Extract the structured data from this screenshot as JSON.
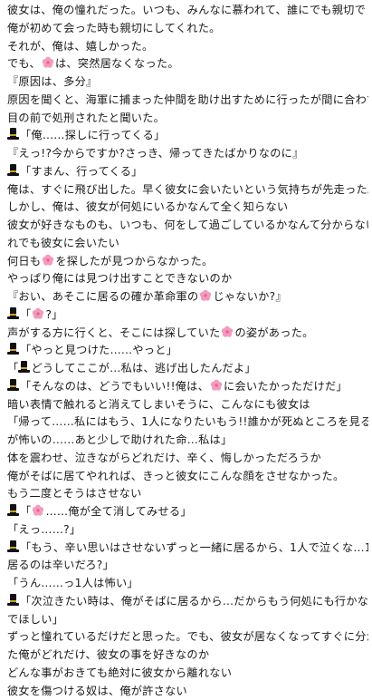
{
  "icons": {
    "hat": "top-hat-icon",
    "flower": "cherry-blossom-icon"
  },
  "colors": {
    "text": "#1a1a1a",
    "background": "#ffffff",
    "flower": "#f29bbf",
    "hat": "#111111"
  },
  "lines": [
    {
      "segments": [
        {
          "t": "text",
          "v": "彼女は、俺の憧れだった。いつも、みんなに慕われて、誰にでも親切で"
        }
      ]
    },
    {
      "segments": [
        {
          "t": "text",
          "v": "俺が初めて会った時も親切にしてくれた。"
        }
      ]
    },
    {
      "segments": [
        {
          "t": "text",
          "v": "それが、俺は、嬉しかった。"
        }
      ]
    },
    {
      "segments": [
        {
          "t": "text",
          "v": "でも、"
        },
        {
          "t": "flower"
        },
        {
          "t": "text",
          "v": "は、突然居なくなった。"
        }
      ]
    },
    {
      "segments": [
        {
          "t": "text",
          "v": "『原因は、多分』"
        }
      ]
    },
    {
      "segments": [
        {
          "t": "text",
          "v": "原因を聞くと、海軍に捕まった仲間を助け出すために行ったが間に合わず"
        }
      ]
    },
    {
      "segments": [
        {
          "t": "text",
          "v": "目の前で処刑されたと聞いた。"
        }
      ]
    },
    {
      "segments": [
        {
          "t": "hat"
        },
        {
          "t": "text",
          "v": "「俺……探しに行ってくる」"
        }
      ]
    },
    {
      "segments": [
        {
          "t": "text",
          "v": "『えっ!?今からですか?さっき、帰ってきたばかりなのに』"
        }
      ]
    },
    {
      "segments": [
        {
          "t": "hat"
        },
        {
          "t": "text",
          "v": "「すまん、行ってくる」"
        }
      ]
    },
    {
      "segments": [
        {
          "t": "text",
          "v": "俺は、すぐに飛び出した。早く彼女に会いたいという気持ちが先走った。"
        }
      ]
    },
    {
      "segments": [
        {
          "t": "text",
          "v": "しかし、俺は、彼女が何処にいるかなんて全く知らない"
        }
      ]
    },
    {
      "segments": [
        {
          "t": "text",
          "v": "彼女が好きなものも、いつも、何をして過ごしているかなんて分からない、そ"
        }
      ]
    },
    {
      "segments": [
        {
          "t": "text",
          "v": "れでも彼女に会いたい"
        }
      ]
    },
    {
      "segments": [
        {
          "t": "text",
          "v": "何日も"
        },
        {
          "t": "flower"
        },
        {
          "t": "text",
          "v": "を探したが見つからなかった。"
        }
      ]
    },
    {
      "segments": [
        {
          "t": "text",
          "v": "やっぱり俺には見つけ出すことできないのか"
        }
      ]
    },
    {
      "segments": [
        {
          "t": "text",
          "v": "『おい、あそこに居るの確か革命軍の"
        },
        {
          "t": "flower"
        },
        {
          "t": "text",
          "v": "じゃないか?』"
        }
      ]
    },
    {
      "segments": [
        {
          "t": "hat"
        },
        {
          "t": "text",
          "v": "「"
        },
        {
          "t": "flower"
        },
        {
          "t": "text",
          "v": "?」"
        }
      ]
    },
    {
      "segments": [
        {
          "t": "text",
          "v": "声がする方に行くと、そこには探していた"
        },
        {
          "t": "flower"
        },
        {
          "t": "text",
          "v": "の姿があった。"
        }
      ]
    },
    {
      "segments": [
        {
          "t": "hat"
        },
        {
          "t": "text",
          "v": "「やっと見つけた……やっと」"
        }
      ]
    },
    {
      "segments": [
        {
          "t": "text",
          "v": "「"
        },
        {
          "t": "hat"
        },
        {
          "t": "text",
          "v": "どうしてここが…私は、逃げ出したんだよ」"
        }
      ]
    },
    {
      "segments": [
        {
          "t": "hat"
        },
        {
          "t": "text",
          "v": "「そんなのは、どうでもいい!!俺は、"
        },
        {
          "t": "flower"
        },
        {
          "t": "text",
          "v": "に会いたかっただけだ」"
        }
      ]
    },
    {
      "segments": [
        {
          "t": "text",
          "v": "暗い表情で触れると消えてしまいそうに、こんなにも彼女は"
        }
      ]
    },
    {
      "segments": [
        {
          "t": "text",
          "v": "「帰って……私にはもう、1人になりたいもう!!誰かが死ぬところを見るの"
        }
      ]
    },
    {
      "segments": [
        {
          "t": "text",
          "v": "が怖いの……あと少しで助けれた命…私は」"
        }
      ]
    },
    {
      "segments": [
        {
          "t": "text",
          "v": "体を震わせ、泣きながらどれだけ、辛く、悔しかっただろうか"
        }
      ]
    },
    {
      "segments": [
        {
          "t": "text",
          "v": "俺がそばに居てやれれば、きっと彼女にこんな顔をさせなかった。"
        }
      ]
    },
    {
      "segments": [
        {
          "t": "text",
          "v": "もう二度とそうはさせない"
        }
      ]
    },
    {
      "segments": [
        {
          "t": "hat"
        },
        {
          "t": "text",
          "v": "「"
        },
        {
          "t": "flower"
        },
        {
          "t": "text",
          "v": "……俺が全て消してみせる」"
        }
      ]
    },
    {
      "segments": [
        {
          "t": "text",
          "v": "「えっ……?」"
        }
      ]
    },
    {
      "segments": [
        {
          "t": "hat"
        },
        {
          "t": "text",
          "v": "「もう、辛い思いはさせないずっと一緒に居るから、1人で泣くな…1人で"
        }
      ]
    },
    {
      "segments": [
        {
          "t": "text",
          "v": "居るのは辛いだろ?」"
        }
      ]
    },
    {
      "segments": [
        {
          "t": "text",
          "v": "「うん……っ1人は怖い」"
        }
      ]
    },
    {
      "segments": [
        {
          "t": "hat"
        },
        {
          "t": "text",
          "v": "「次泣きたい時は、俺がそばに居るから…だからもう何処にも行かないで"
        }
      ]
    },
    {
      "segments": [
        {
          "t": "text",
          "v": "でほしい」"
        }
      ]
    },
    {
      "segments": [
        {
          "t": "text",
          "v": "ずっと憧れているだけだと思った。でも、彼女が居なくなってすぐに分かっ"
        }
      ]
    },
    {
      "segments": [
        {
          "t": "text",
          "v": "た俺がどれだけ、彼女の事を好きなのか"
        }
      ]
    },
    {
      "segments": [
        {
          "t": "text",
          "v": "どんな事がおきても絶対に彼女から離れない"
        }
      ]
    },
    {
      "segments": [
        {
          "t": "text",
          "v": "彼女を傷つける奴は、俺が許さない"
        }
      ]
    }
  ]
}
